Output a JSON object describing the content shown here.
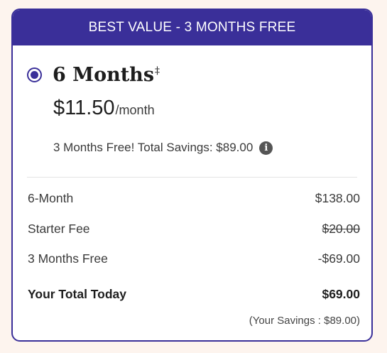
{
  "banner": {
    "text": "BEST VALUE - 3 MONTHS FREE"
  },
  "plan": {
    "selected": true,
    "name": "6 Months",
    "footnote_mark": "‡",
    "price": "$11.50",
    "price_unit": "/month",
    "savings_text": "3 Months Free! Total Savings: $89.00"
  },
  "breakdown": [
    {
      "label": "6-Month",
      "amount": "$138.00",
      "struck": false
    },
    {
      "label": "Starter Fee",
      "amount": "$20.00",
      "struck": true
    },
    {
      "label": "3 Months Free",
      "amount": "-$69.00",
      "struck": false
    }
  ],
  "total": {
    "label": "Your Total Today",
    "amount": "$69.00"
  },
  "your_savings": "(Your Savings : $89.00)",
  "colors": {
    "accent": "#3a2f99",
    "background": "#fdf4ee",
    "card": "#ffffff",
    "info_icon": "#555555"
  },
  "icons": {
    "info": "info-icon"
  }
}
